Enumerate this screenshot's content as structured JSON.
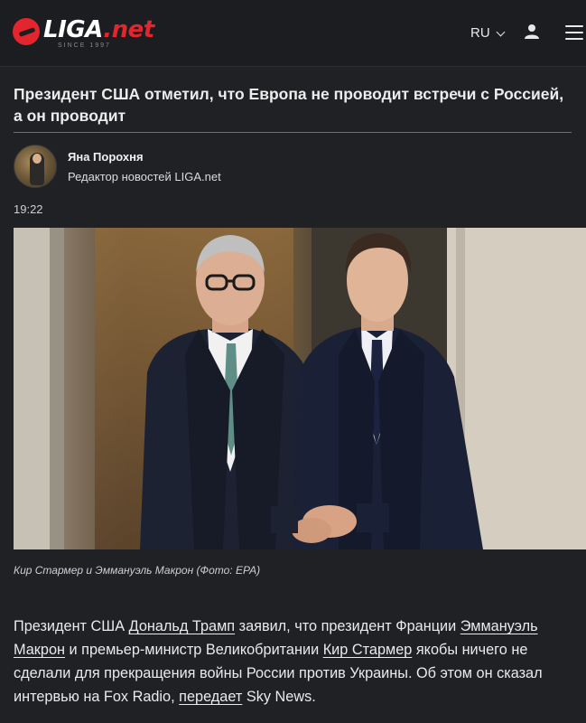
{
  "header": {
    "logo_main": "LIGA",
    "logo_suffix": ".net",
    "logo_since": "SINCE 1997",
    "language": "RU",
    "icons": {
      "logo": "liga-logo-icon",
      "language_chevron": "chevron-down-icon",
      "user": "user-icon",
      "menu": "hamburger-menu-icon"
    }
  },
  "article": {
    "title": "Президент США отметил, что Европа не проводит встречи с Россией, а он проводит",
    "author": {
      "name": "Яна Порохня",
      "role": "Редактор новостей LIGA.net"
    },
    "time": "19:22",
    "photo_caption": "Кир Стармер и Эммануэль Макрон (Фото: EPA)",
    "body": {
      "part1": "Президент США ",
      "link1": "Дональд Трамп",
      "part2": " заявил, что президент Франции ",
      "link2": "Эммануэль Макрон",
      "part3": " и премьер-министр Великобритании ",
      "link3": "Кир Стармер",
      "part4": " якобы ничего не сделали для прекращения войны России против Украины. Об этом он сказал интервью на Fox Radio, ",
      "link4": "передает",
      "part5": " Sky News."
    }
  },
  "colors": {
    "background": "#1f2124",
    "brand_red": "#e3262d",
    "text": "#eaeaea"
  }
}
